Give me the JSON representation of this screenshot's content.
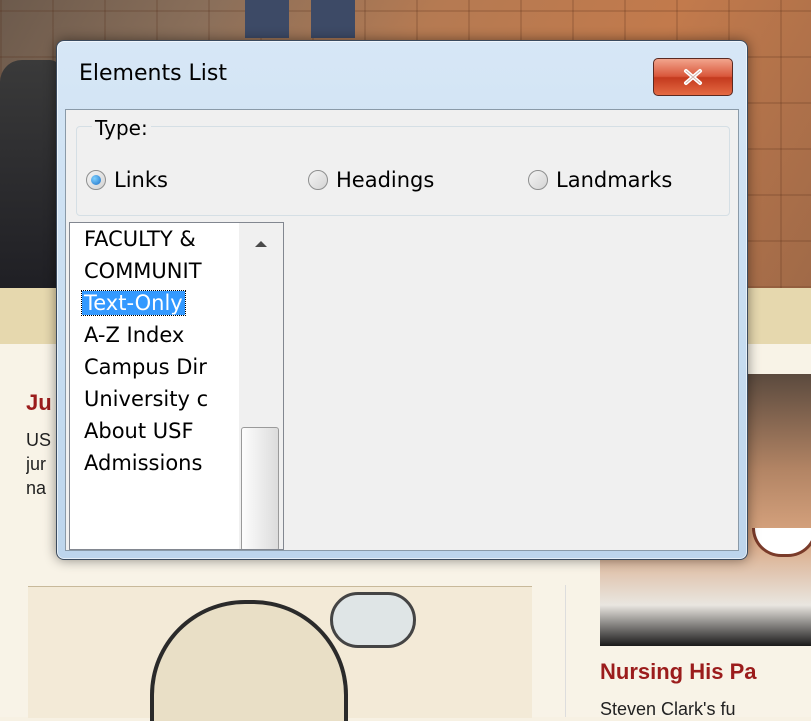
{
  "background_page": {
    "story1": {
      "title": "Ju",
      "lines": [
        "US",
        "jur",
        "na"
      ]
    },
    "story2": {
      "title": "Nursing His Pa",
      "snippet": "Steven Clark's fu"
    }
  },
  "dialog": {
    "title": "Elements List",
    "close_icon": "close-icon",
    "type_group": {
      "label": "Type:",
      "options": [
        {
          "label": "Links",
          "selected": true
        },
        {
          "label": "Headings",
          "selected": false
        },
        {
          "label": "Landmarks",
          "selected": false
        }
      ]
    },
    "list": {
      "items": [
        "FACULTY &",
        "COMMUNIT",
        "Text-Only",
        "A-Z Index",
        "Campus Dir",
        "University c",
        "About USF",
        "Admissions"
      ],
      "selected_index": 2
    },
    "colors": {
      "accent": "#3399ff",
      "close_button": "#d9573b"
    }
  }
}
